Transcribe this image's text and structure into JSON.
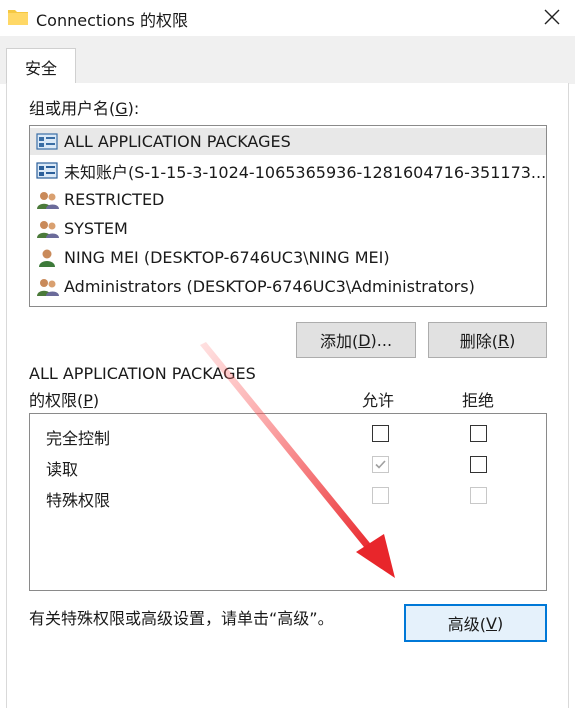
{
  "window": {
    "title": "Connections 的权限",
    "close_icon": "close-icon"
  },
  "tabs": [
    {
      "label": "安全"
    }
  ],
  "groups": {
    "label_text": "组或用户名(",
    "label_key": "G",
    "label_tail": "):",
    "items": [
      {
        "name": "ALL APPLICATION PACKAGES",
        "icon": "app-packages-icon"
      },
      {
        "name": "未知账户(S-1-15-3-1024-1065365936-1281604716-351173...",
        "icon": "unknown-account-icon"
      },
      {
        "name": "RESTRICTED",
        "icon": "group-icon"
      },
      {
        "name": "SYSTEM",
        "icon": "group-icon"
      },
      {
        "name": "NING MEI (DESKTOP-6746UC3\\NING MEI)",
        "icon": "user-icon"
      },
      {
        "name": "Administrators (DESKTOP-6746UC3\\Administrators)",
        "icon": "group-icon"
      }
    ]
  },
  "buttons": {
    "add": {
      "text": "添加(",
      "key": "D",
      "tail": ")..."
    },
    "remove": {
      "text": "删除(",
      "key": "R",
      "tail": ")"
    },
    "advanced": {
      "text": "高级(",
      "key": "V",
      "tail": ")"
    }
  },
  "permissions": {
    "subject": "ALL APPLICATION PACKAGES",
    "label_text": "的权限(",
    "label_key": "P",
    "label_tail": ")",
    "allow_header": "允许",
    "deny_header": "拒绝",
    "rows": [
      {
        "name": "完全控制",
        "allow": false,
        "allow_disabled": false,
        "deny": false,
        "deny_disabled": false
      },
      {
        "name": "读取",
        "allow": true,
        "allow_disabled": true,
        "deny": false,
        "deny_disabled": false
      },
      {
        "name": "特殊权限",
        "allow": false,
        "allow_disabled": true,
        "deny": false,
        "deny_disabled": true
      }
    ]
  },
  "footer_note": "有关特殊权限或高级设置，请单击“高级”。",
  "colors": {
    "accent": "#0078d7",
    "arrow": "#e8262b"
  }
}
